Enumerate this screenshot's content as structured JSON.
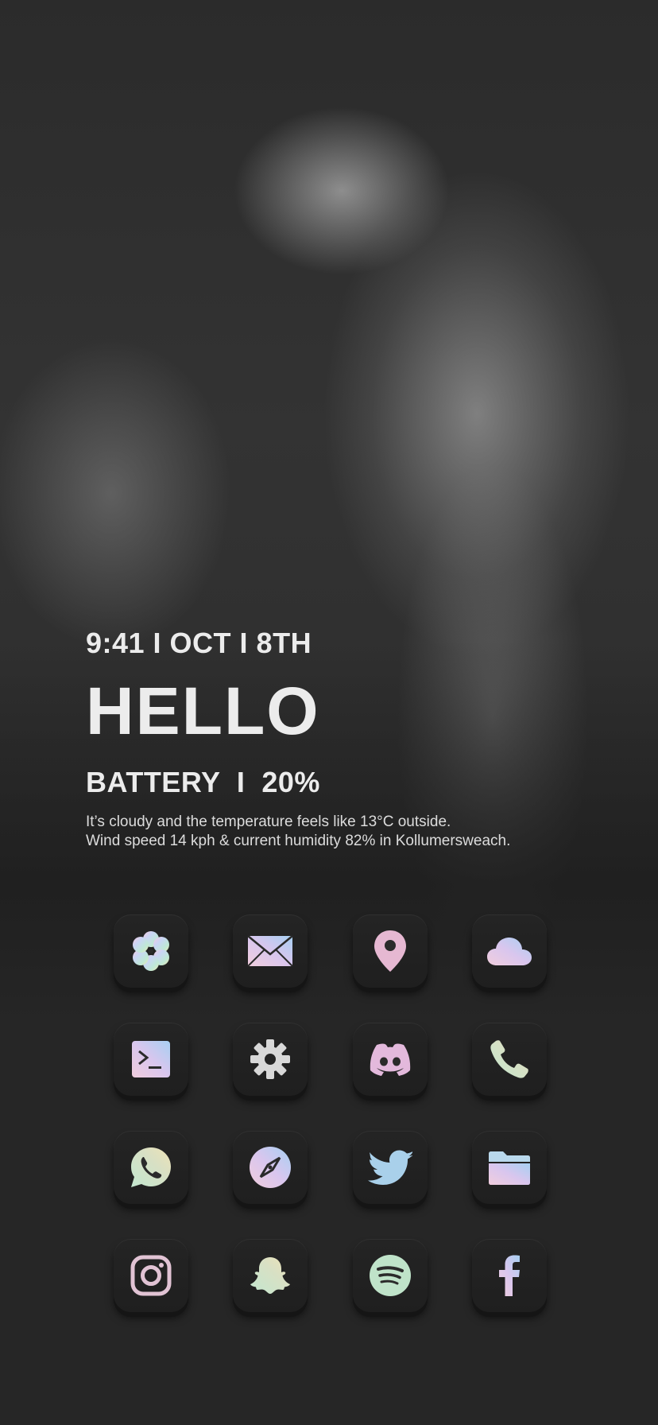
{
  "status": {
    "time_line": "9:41 I OCT I 8TH",
    "greeting": "HELLO",
    "battery_line": "BATTERY  I  20%"
  },
  "weather": {
    "line1": "It’s cloudy and the temperature feels like 13°C outside.",
    "line2": "Wind speed 14 kph & current humidity 82% in Kollumersweach."
  },
  "apps": [
    {
      "icon": "flower-icon"
    },
    {
      "icon": "mail-icon"
    },
    {
      "icon": "map-pin-icon"
    },
    {
      "icon": "cloud-icon"
    },
    {
      "icon": "terminal-icon"
    },
    {
      "icon": "gear-icon"
    },
    {
      "icon": "discord-icon"
    },
    {
      "icon": "phone-icon"
    },
    {
      "icon": "whatsapp-icon"
    },
    {
      "icon": "compass-icon"
    },
    {
      "icon": "twitter-icon"
    },
    {
      "icon": "folder-icon"
    },
    {
      "icon": "instagram-icon"
    },
    {
      "icon": "snapchat-icon"
    },
    {
      "icon": "spotify-icon"
    },
    {
      "icon": "facebook-icon"
    }
  ],
  "colors": {
    "background": "#262626",
    "text": "#ececec",
    "tile": "#222222",
    "holo_pink": "#e6b8d8",
    "holo_blue": "#a9c8ef",
    "holo_mint": "#bfe6d0",
    "holo_yellow": "#ece4b0"
  }
}
